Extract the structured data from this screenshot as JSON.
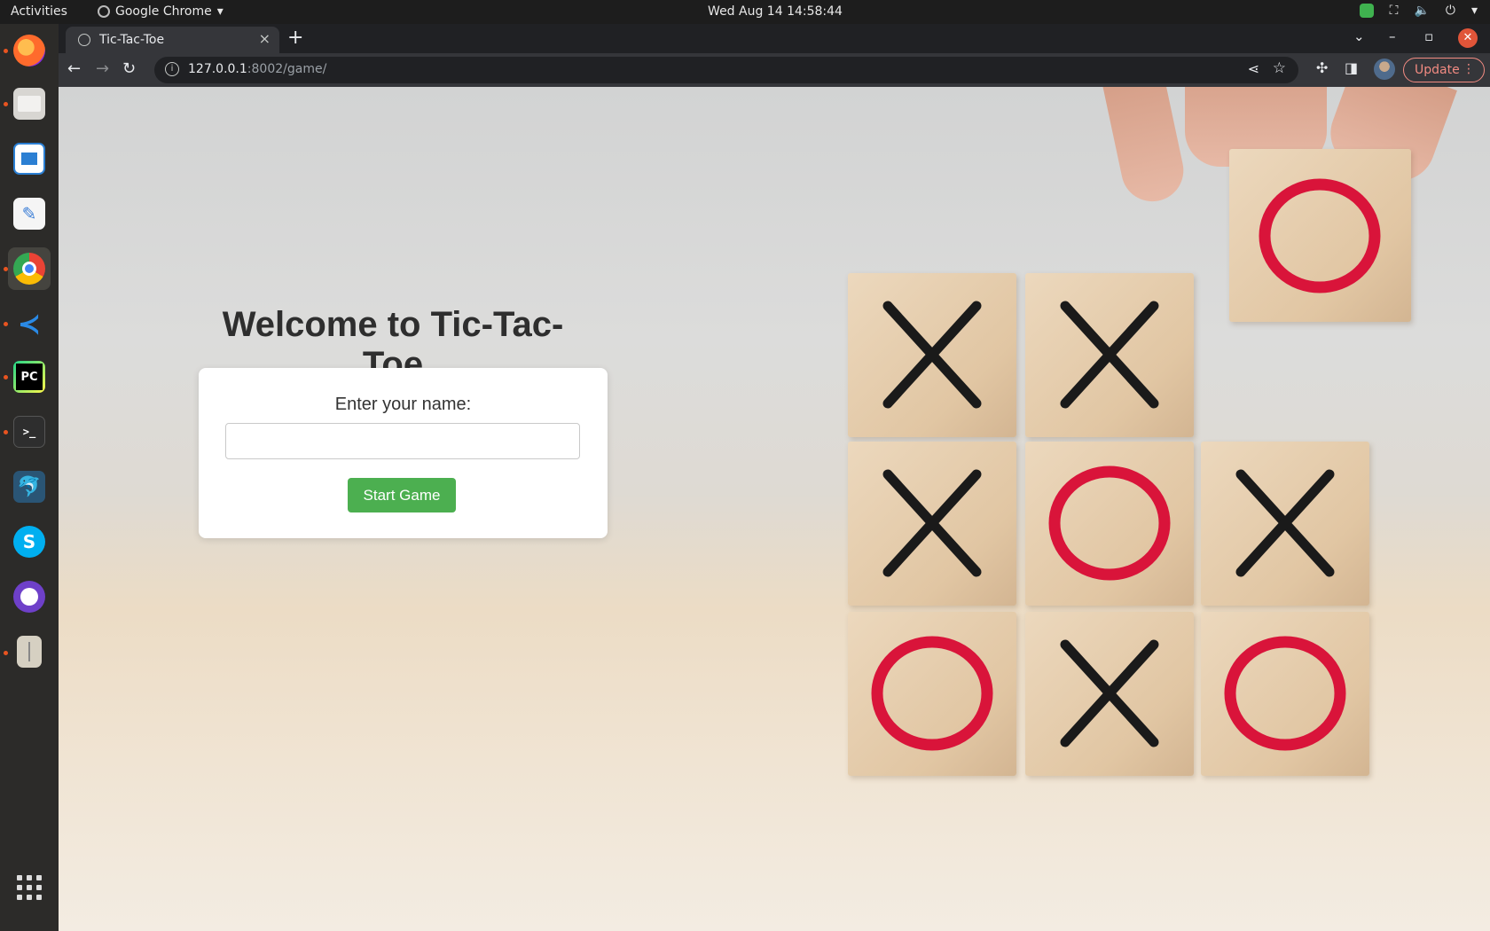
{
  "system": {
    "activities": "Activities",
    "app_menu": "Google Chrome",
    "clock": "Wed Aug 14  14:58:44"
  },
  "dock": {
    "apps": [
      "firefox-icon",
      "files-icon",
      "libreoffice-writer-icon",
      "text-editor-icon",
      "chrome-icon",
      "vscode-icon",
      "pycharm-icon",
      "terminal-icon",
      "mysql-workbench-icon",
      "skype-icon",
      "github-desktop-icon",
      "archive-manager-icon"
    ],
    "pycharm_label": "PC",
    "terminal_label": ">_",
    "skype_label": "S"
  },
  "browser": {
    "tab_title": "Tic-Tac-Toe",
    "url_host": "127.0.0.1",
    "url_rest": ":8002/game/",
    "update_label": "Update"
  },
  "page": {
    "heading": "Welcome to Tic-Tac-Toe",
    "name_label": "Enter your name:",
    "name_value": "",
    "start_button": "Start Game"
  },
  "image": {
    "board": [
      [
        "X",
        "X",
        "O"
      ],
      [
        "X",
        "O",
        "X"
      ],
      [
        "O",
        "X",
        "O"
      ]
    ],
    "colors": {
      "x": "#1a1a1a",
      "o": "#d9143a"
    }
  },
  "colors": {
    "start_button": "#4caf50",
    "update_accent": "#f28b82",
    "close_button": "#e05539"
  }
}
